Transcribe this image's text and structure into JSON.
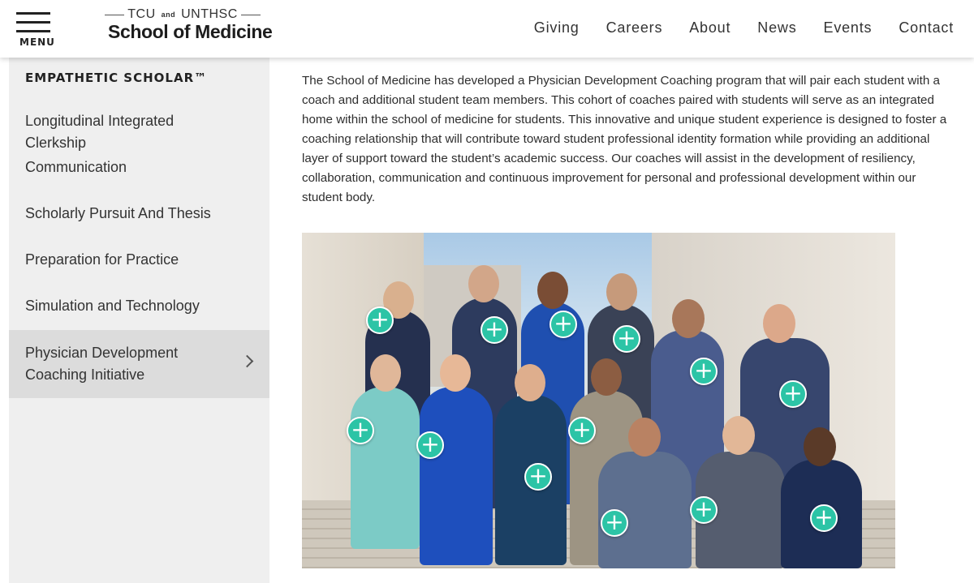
{
  "header": {
    "menu_label": "MENU",
    "logo_top_left": "TCU",
    "logo_and": "and",
    "logo_top_right": "UNTHSC",
    "logo_main": "School of Medicine",
    "nav": [
      "Giving",
      "Careers",
      "About",
      "News",
      "Events",
      "Contact"
    ]
  },
  "sidebar": {
    "heading": "EMPATHETIC SCHOLAR™",
    "items": [
      {
        "label": "Longitudinal Integrated Clerkship"
      },
      {
        "label": "Communication"
      },
      {
        "label": "Scholarly Pursuit And Thesis"
      },
      {
        "label": "Preparation for Practice"
      },
      {
        "label": "Simulation and Technology"
      },
      {
        "label": "Physician Development Coaching Initiative"
      }
    ]
  },
  "main": {
    "intro": "The School of Medicine has developed a Physician Development Coaching program that will pair each student with a coach and additional student team members. This cohort of coaches paired with students will serve as an integrated home within the school of medicine for students. This innovative and unique student experience is designed to foster a coaching relationship that will contribute toward student professional identity formation while providing an additional layer of support toward the student’s academic success. Our coaches will assist in the development of resiliency, collaboration, communication and continuous improvement for personal and professional development within our student body.",
    "hotspot_symbol": "+"
  },
  "colors": {
    "accent_teal": "#2cc4a6",
    "sidebar_bg": "#efefef",
    "sidebar_active": "#dcdcdc"
  },
  "icons": {
    "menu": "hamburger-icon",
    "active_item": "chevron-right-icon",
    "hotspot": "plus-icon"
  }
}
